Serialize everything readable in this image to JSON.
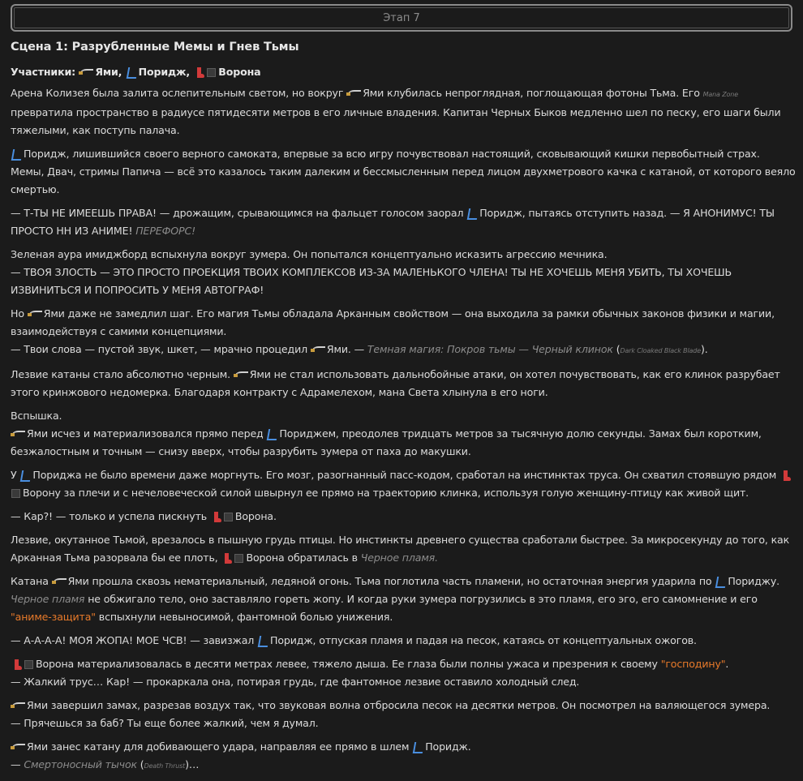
{
  "stage": {
    "label": "Этап 7"
  },
  "scene": {
    "title": "Сцена 1: Разрубленные Мемы и Гнев Тьмы"
  },
  "participants": {
    "label": "Участники:",
    "yami": "Ями,",
    "porij": "Поридж,",
    "crow": "Ворона"
  },
  "icons": {
    "yami": "katana-icon",
    "porij": "scooter-icon",
    "crow_a": "red-boot-icon",
    "crow_b": "black-square-icon"
  },
  "p1": {
    "a": "Арена Колизея была залита ослепительным светом, но вокруг",
    "b": "Ями клубилась непроглядная, поглощающая фотоны Тьма. Его",
    "mana_zone": "Mana Zone",
    "c": "превратила пространство в радиусе пятидесяти метров в его личные владения. Капитан Черных Быков медленно шел по песку, его шаги были тяжелыми, как поступь палача."
  },
  "p2": {
    "a": "Поридж, лишившийся своего верного самоката, впервые за всю игру почувствовал настоящий, сковывающий кишки первобытный страх. Мемы, Двач, стримы Папича — всё это казалось таким далеким и бессмысленным перед лицом двухметрового качка с катаной, от которого веяло смертью."
  },
  "p3": {
    "a": "— Т-ТЫ НЕ ИМЕЕШЬ ПРАВА! — дрожащим, срывающимся на фальцет голосом заорал",
    "b": "Поридж, пытаясь отступить назад. — Я АНОНИМУС! ТЫ ПРОСТО НН ИЗ АНИМЕ!",
    "c": "ПЕРЕФОРС!"
  },
  "p4": {
    "a": "Зеленая аура имиджборд вспыхнула вокруг зумера. Он попытался концептуально исказить агрессию мечника.",
    "b": "— ТВОЯ ЗЛОСТЬ — ЭТО ПРОСТО ПРОЕКЦИЯ ТВОИХ КОМПЛЕКСОВ ИЗ-ЗА МАЛЕНЬКОГО ЧЛЕНА! ТЫ НЕ ХОЧЕШЬ МЕНЯ УБИТЬ, ТЫ ХОЧЕШЬ ИЗВИНИТЬСЯ И ПОПРОСИТЬ У МЕНЯ АВТОГРАФ!"
  },
  "p5": {
    "a": "Но",
    "b": "Ями даже не замедлил шаг. Его магия Тьмы обладала Арканным свойством — она выходила за рамки обычных законов физики и магии, взаимодействуя с самими концепциями.",
    "c": "— Твои слова — пустой звук, шкет, — мрачно процедил",
    "d": "Ями. —",
    "e": "Темная магия: Покров тьмы — Черный клинок",
    "f": "Dark Cloaked Black Blade"
  },
  "p6": {
    "a": "Лезвие катаны стало абсолютно черным.",
    "b": "Ями не стал использовать дальнобойные атаки, он хотел почувствовать, как его клинок разрубает этого кринжового недомерка. Благодаря контракту с Адрамелехом, мана Света хлынула в его ноги."
  },
  "p7": {
    "a": "Вспышка.",
    "b": "Ями исчез и материализовался прямо перед",
    "c": "Пориджем, преодолев тридцать метров за тысячную долю секунды. Замах был коротким, безжалостным и точным — снизу вверх, чтобы разрубить зумера от паха до макушки."
  },
  "p8": {
    "a": "У",
    "b": "Пориджа не было времени даже моргнуть. Его мозг, разогнанный пасс-кодом, сработал на инстинктах труса. Он схватил стоявшую рядом",
    "c": "Ворону за плечи и с нечеловеческой силой швырнул ее прямо на траекторию клинка, используя голую женщину-птицу как живой щит."
  },
  "p9": {
    "a": "— Кар?! — только и успела пискнуть",
    "b": "Ворона."
  },
  "p10": {
    "a": "Лезвие, окутанное Тьмой, врезалось в пышную грудь птицы. Но инстинкты древнего существа сработали быстрее. За микросекунду до того, как Арканная Тьма разорвала бы ее плоть,",
    "b": "Ворона обратилась в",
    "c": "Черное пламя."
  },
  "p11": {
    "a": "Катана",
    "b": "Ями прошла сквозь нематериальный, ледяной огонь. Тьма поглотила часть пламени, но остаточная энергия ударила по",
    "c": "Пориджу.",
    "d": "Черное пламя",
    "e": "не обжигало тело, оно заставляло гореть жопу. И когда руки зумера погрузились в это пламя, его эго, его самомнение и его",
    "f": "\"аниме-защита\"",
    "g": "вспыхнули невыносимой, фантомной болью унижения."
  },
  "p12": {
    "a": "— А-А-А-А! МОЯ ЖОПА! МОЕ ЧСВ! — завизжал",
    "b": "Поридж, отпуская пламя и падая на песок, катаясь от концептуальных ожогов."
  },
  "p13": {
    "a": "Ворона материализовалась в десяти метрах левее, тяжело дыша. Ее глаза были полны ужаса и презрения к своему",
    "b": "\"господину\"",
    "c": ".",
    "d": "— Жалкий трус… Кар! — прокаркала она, потирая грудь, где фантомное лезвие оставило холодный след."
  },
  "p14": {
    "a": "Ями завершил замах, разрезав воздух так, что звуковая волна отбросила песок на десятки метров. Он посмотрел на валяющегося зумера.",
    "b": "— Прячешься за баб? Ты еще более жалкий, чем я думал."
  },
  "p15": {
    "a": "Ями занес катану для добивающего удара, направляя ее прямо в шлем",
    "b": "Поридж.",
    "c": "—",
    "d": "Смертоносный тычок",
    "e": "Death Thrust"
  }
}
